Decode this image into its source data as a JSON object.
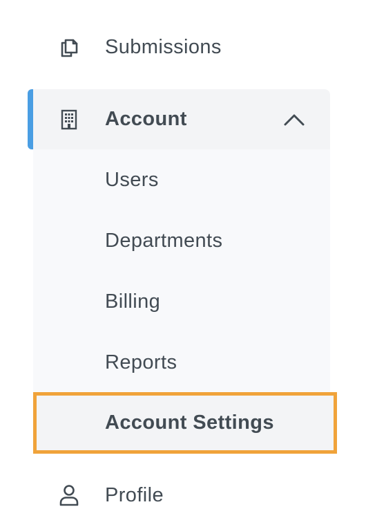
{
  "nav": {
    "submissions": {
      "label": "Submissions",
      "icon": "copy-icon"
    },
    "account": {
      "label": "Account",
      "icon": "building-icon",
      "toggle_icon": "chevron-up-icon",
      "accent_color": "#4a9ee3",
      "expanded": true,
      "items": [
        {
          "label": "Users"
        },
        {
          "label": "Departments"
        },
        {
          "label": "Billing"
        },
        {
          "label": "Reports"
        },
        {
          "label": "Account Settings",
          "highlighted": true,
          "highlight_color": "#f0a33a"
        }
      ]
    },
    "profile": {
      "label": "Profile",
      "icon": "user-icon"
    }
  }
}
